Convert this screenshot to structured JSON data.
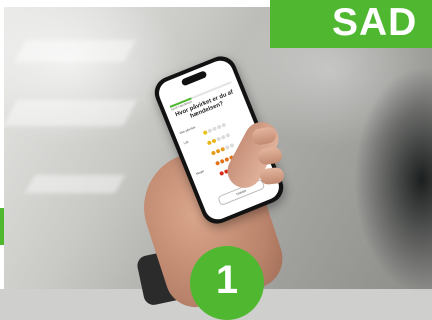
{
  "banner": {
    "text": "SAD"
  },
  "badge": {
    "number": "1"
  },
  "phone": {
    "app_title": "Sprik hændelsen",
    "progress_fraction": 0.35,
    "question": "Hvor påvirket er du af hændelsen?",
    "rating_rows": [
      {
        "label": "Ikke påvirket",
        "filled": 1,
        "color": "#e8c21a"
      },
      {
        "label": "Lidt",
        "filled": 2,
        "color": "#e8b41a"
      },
      {
        "label": "",
        "filled": 3,
        "color": "#e79a18"
      },
      {
        "label": "",
        "filled": 4,
        "color": "#e2731a"
      },
      {
        "label": "Meget",
        "filled": 5,
        "color": "#d92a1a"
      }
    ],
    "next_label": "Næste"
  },
  "colors": {
    "accent_green": "#4fb830"
  }
}
